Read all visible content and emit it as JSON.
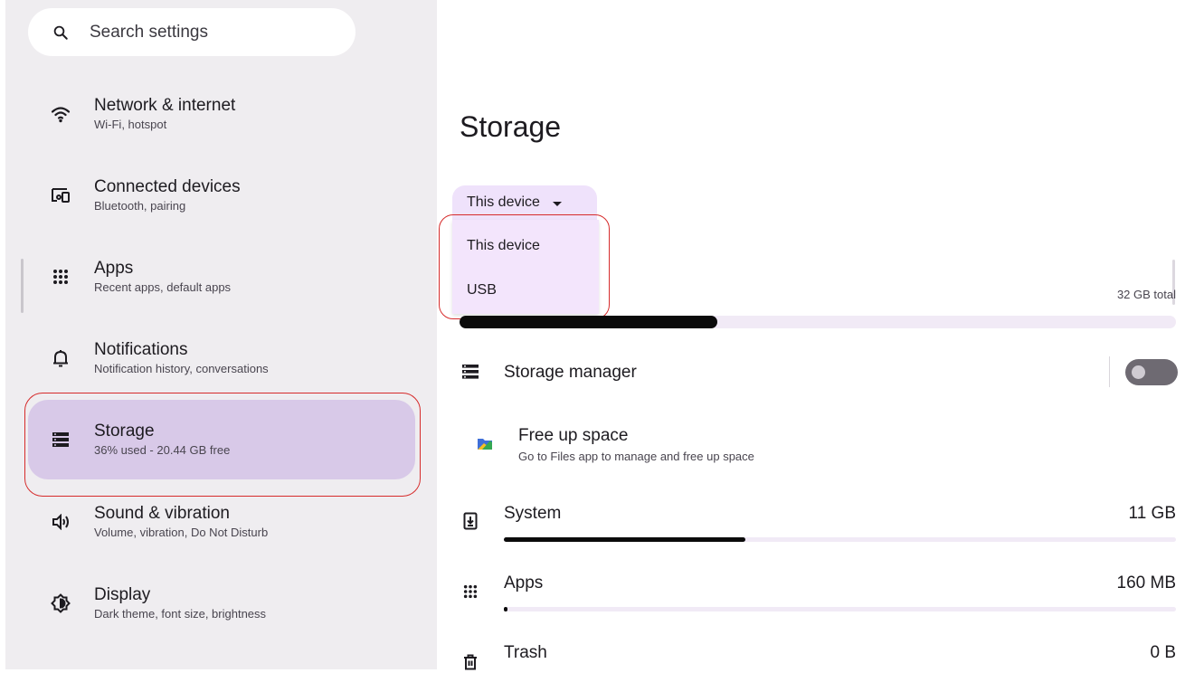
{
  "search": {
    "placeholder": "Search settings"
  },
  "sidebar": {
    "items": [
      {
        "title": "Network & internet",
        "subtitle": "Wi-Fi, hotspot",
        "icon": "wifi-icon"
      },
      {
        "title": "Connected devices",
        "subtitle": "Bluetooth, pairing",
        "icon": "devices-icon"
      },
      {
        "title": "Apps",
        "subtitle": "Recent apps, default apps",
        "icon": "apps-grid-icon"
      },
      {
        "title": "Notifications",
        "subtitle": "Notification history, conversations",
        "icon": "bell-icon"
      },
      {
        "title": "Storage",
        "subtitle": "36% used - 20.44 GB free",
        "icon": "storage-icon",
        "selected": true
      },
      {
        "title": "Sound & vibration",
        "subtitle": "Volume, vibration, Do Not Disturb",
        "icon": "volume-icon"
      },
      {
        "title": "Display",
        "subtitle": "Dark theme, font size, brightness",
        "icon": "display-icon"
      }
    ]
  },
  "main": {
    "title": "Storage",
    "volume_select": {
      "value": "This device",
      "options": [
        "This device",
        "USB"
      ]
    },
    "total_label": "32 GB total",
    "used_fraction": 0.36,
    "storage_manager": {
      "label": "Storage manager",
      "enabled": false
    },
    "free_up": {
      "title": "Free up space",
      "subtitle": "Go to Files app to manage and free up space"
    },
    "categories": [
      {
        "label": "System",
        "value": "11 GB",
        "fraction": 0.36,
        "icon": "system-update-icon"
      },
      {
        "label": "Apps",
        "value": "160 MB",
        "fraction": 0.005,
        "icon": "apps-grid-icon"
      },
      {
        "label": "Trash",
        "value": "0 B",
        "fraction": 0,
        "icon": "trash-icon"
      }
    ]
  },
  "colors": {
    "sidebar_bg": "#efedf0",
    "selected_bg": "#d8c9e8",
    "dropdown_bg": "#efe2fb",
    "highlight": "#d62b2b",
    "bar_fill": "#0b0b0b",
    "bar_track": "#f1eaf6"
  }
}
